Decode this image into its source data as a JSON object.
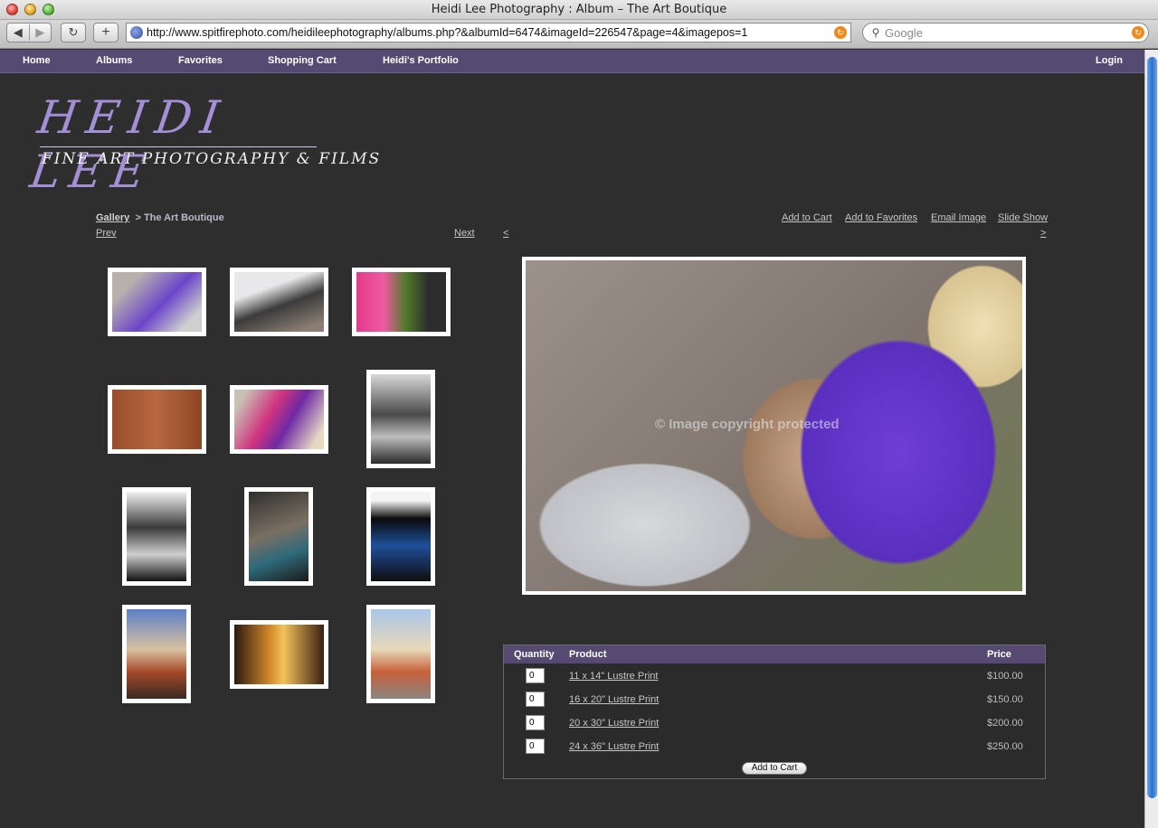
{
  "browser": {
    "window_title": "Heidi Lee Photography : Album – The Art Boutique",
    "url": "http://www.spitfirephoto.com/heidileephotography/albums.php?&albumId=6474&imageId=226547&page=4&imagepos=1",
    "search_placeholder": "Google",
    "back_glyph": "◀",
    "forward_glyph": "▶",
    "reload_glyph": "↻",
    "add_glyph": "+"
  },
  "nav": {
    "items": [
      "Home",
      "Albums",
      "Favorites",
      "Shopping Cart",
      "Heidi's Portfolio"
    ],
    "login": "Login"
  },
  "logo": {
    "main": "HEIDI LEE",
    "sub": "FINE ART PHOTOGRAPHY & FILMS"
  },
  "breadcrumb": {
    "gallery": "Gallery",
    "separator": ">",
    "current": "The Art Boutique"
  },
  "pager": {
    "prev": "Prev",
    "next": "Next",
    "img_prev": "<",
    "img_next": ">"
  },
  "actions": [
    "Add to Cart",
    "Add to Favorites",
    "Email Image",
    "Slide Show"
  ],
  "watermark": "© Image copyright protected",
  "colors": {
    "nav_bg": "#554a72",
    "page_bg": "#2e2e2e",
    "logo_accent": "#a38fd6"
  },
  "table": {
    "headers": {
      "quantity": "Quantity",
      "product": "Product",
      "price": "Price"
    },
    "rows": [
      {
        "qty": "0",
        "product": "11 x 14\" Lustre Print",
        "price": "$100.00"
      },
      {
        "qty": "0",
        "product": "16 x 20\" Lustre Print",
        "price": "$150.00"
      },
      {
        "qty": "0",
        "product": "20 x 30\" Lustre Print",
        "price": "$200.00"
      },
      {
        "qty": "0",
        "product": "24 x 36\" Lustre Print",
        "price": "$250.00"
      }
    ],
    "add_to_cart": "Add to Cart"
  }
}
